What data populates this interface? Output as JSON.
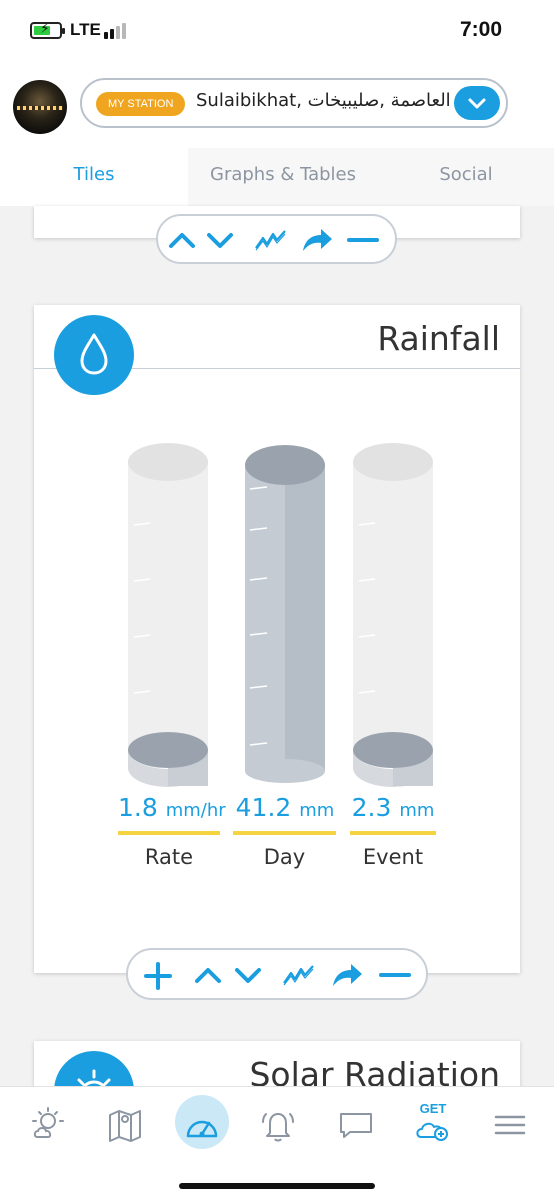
{
  "status_bar": {
    "network": "LTE",
    "time": "7:00"
  },
  "header": {
    "station_badge": "MY STATION",
    "station_name": "Sulaibikhat, العاصمة ,صليبيخات"
  },
  "tabs": [
    {
      "label": "Tiles",
      "active": true
    },
    {
      "label": "Graphs & Tables",
      "active": false
    },
    {
      "label": "Social",
      "active": false
    }
  ],
  "rainfall": {
    "title": "Rainfall",
    "items": [
      {
        "value": "1.8",
        "unit": "mm/hr",
        "label": "Rate"
      },
      {
        "value": "41.2",
        "unit": "mm",
        "label": "Day"
      },
      {
        "value": "2.3",
        "unit": "mm",
        "label": "Event"
      }
    ]
  },
  "solar": {
    "title": "Solar Radiation"
  },
  "nav": [
    "weather-icon",
    "map-icon",
    "dashboard-icon",
    "alerts-icon",
    "chat-icon",
    "get-device-icon",
    "menu-icon"
  ],
  "nav_get_label": "GET",
  "colors": {
    "accent": "#1a9ee0",
    "badge": "#f0a520",
    "underline": "#f5d442"
  }
}
